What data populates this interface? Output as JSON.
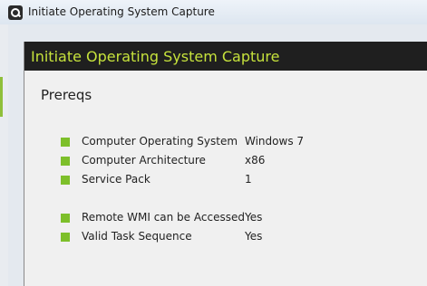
{
  "window": {
    "title": "Initiate Operating System Capture",
    "icon": "app-icon"
  },
  "dialog": {
    "title": "Initiate Operating System Capture",
    "title_color": "#c6e23c",
    "header_color": "#1f1f1f"
  },
  "prereqs": {
    "heading": "Prereqs",
    "status_color": "#7dbf2a",
    "items": [
      {
        "label": "Computer Operating System",
        "value": "Windows 7"
      },
      {
        "label": "Computer Architecture",
        "value": "x86"
      },
      {
        "label": "Service Pack",
        "value": "1"
      },
      {
        "label": "Remote WMI can be Accessed",
        "value": "Yes"
      },
      {
        "label": "Valid Task Sequence",
        "value": "Yes"
      }
    ]
  }
}
